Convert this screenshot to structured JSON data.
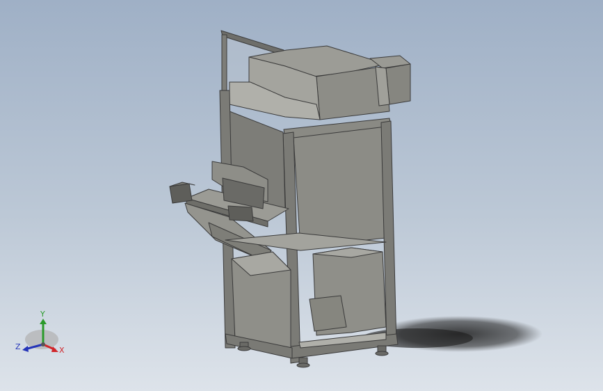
{
  "viewport": {
    "background_top": "#9fb0c6",
    "background_bottom": "#dde3ea",
    "model_color": "#8c8c86",
    "edge_color": "#3a3a3a"
  },
  "triad": {
    "x_label": "X",
    "y_label": "Y",
    "z_label": "Z",
    "x_color": "#d0262a",
    "y_color": "#2a9a2a",
    "z_color": "#2535b8"
  }
}
